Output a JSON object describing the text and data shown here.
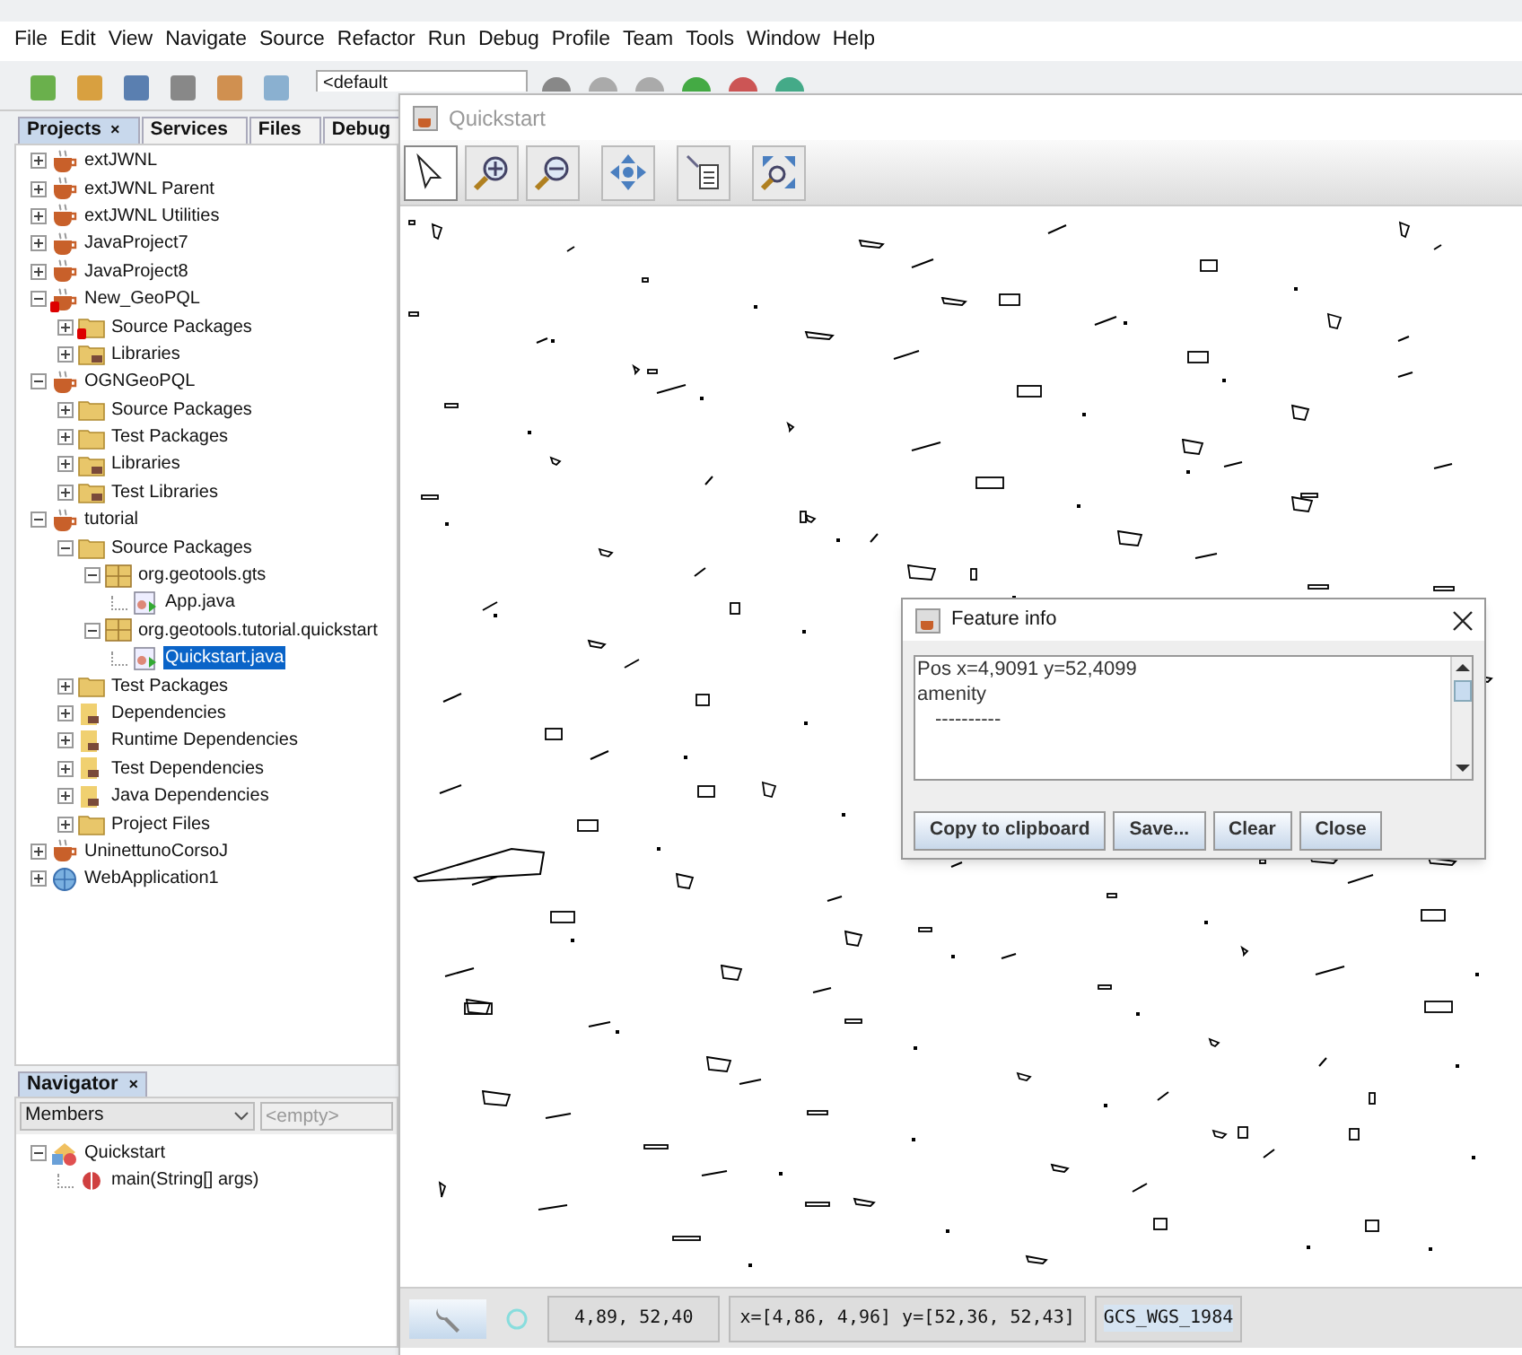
{
  "ide": {
    "menu": [
      "File",
      "Edit",
      "View",
      "Navigate",
      "Source",
      "Refactor",
      "Run",
      "Debug",
      "Profile",
      "Team",
      "Tools",
      "Window",
      "Help"
    ],
    "config_combo": {
      "value": "<default"
    }
  },
  "panel_tabs": [
    {
      "label": "Projects",
      "selected": true,
      "close": "×"
    },
    {
      "label": "Services",
      "selected": false
    },
    {
      "label": "Files",
      "selected": false
    },
    {
      "label": "Debug",
      "selected": false
    }
  ],
  "project_tree": [
    {
      "label": "extJWNL",
      "kind": "project",
      "expanded": false,
      "selected": false
    },
    {
      "label": "extJWNL Parent",
      "kind": "parent",
      "expanded": false,
      "selected": false
    },
    {
      "label": "extJWNL Utilities",
      "kind": "project",
      "expanded": false,
      "selected": false
    },
    {
      "label": "JavaProject7",
      "kind": "project",
      "expanded": false,
      "selected": false
    },
    {
      "label": "JavaProject8",
      "kind": "project",
      "expanded": false,
      "selected": false
    },
    {
      "label": "New_GeoPQL",
      "kind": "project-error",
      "expanded": true,
      "selected": false,
      "children": [
        {
          "label": "Source Packages",
          "kind": "folder-error",
          "expanded": false,
          "selected": false
        },
        {
          "label": "Libraries",
          "kind": "library",
          "expanded": false,
          "selected": false
        }
      ]
    },
    {
      "label": "OGNGeoPQL",
      "kind": "project",
      "expanded": true,
      "selected": false,
      "children": [
        {
          "label": "Source Packages",
          "kind": "folder",
          "expanded": false,
          "selected": false
        },
        {
          "label": "Test Packages",
          "kind": "folder",
          "expanded": false,
          "selected": false
        },
        {
          "label": "Libraries",
          "kind": "library",
          "expanded": false,
          "selected": false
        },
        {
          "label": "Test Libraries",
          "kind": "library",
          "expanded": false,
          "selected": false
        }
      ]
    },
    {
      "label": "tutorial",
      "kind": "project",
      "expanded": true,
      "selected": false,
      "children": [
        {
          "label": "Source Packages",
          "kind": "folder",
          "expanded": true,
          "selected": false,
          "children": [
            {
              "label": "org.geotools.gts",
              "kind": "package",
              "expanded": true,
              "selected": false,
              "children": [
                {
                  "label": "App.java",
                  "kind": "java",
                  "selected": false
                }
              ]
            },
            {
              "label": "org.geotools.tutorial.quickstart",
              "kind": "package",
              "expanded": true,
              "selected": false,
              "children": [
                {
                  "label": "Quickstart.java",
                  "kind": "java",
                  "selected": true
                }
              ]
            }
          ]
        },
        {
          "label": "Test Packages",
          "kind": "folder",
          "expanded": false,
          "selected": false
        },
        {
          "label": "Dependencies",
          "kind": "deps",
          "expanded": false,
          "selected": false
        },
        {
          "label": "Runtime Dependencies",
          "kind": "deps",
          "expanded": false,
          "selected": false
        },
        {
          "label": "Test Dependencies",
          "kind": "deps",
          "expanded": false,
          "selected": false
        },
        {
          "label": "Java Dependencies",
          "kind": "deps",
          "expanded": false,
          "selected": false
        },
        {
          "label": "Project Files",
          "kind": "folder",
          "expanded": false,
          "selected": false
        }
      ]
    },
    {
      "label": "UninettunoCorsoJ",
      "kind": "project",
      "expanded": false,
      "selected": false
    },
    {
      "label": "WebApplication1",
      "kind": "web",
      "expanded": false,
      "selected": false
    }
  ],
  "navigator": {
    "title": "Navigator",
    "close": "×",
    "filter": "Members",
    "search_placeholder": "<empty>",
    "tree": [
      {
        "label": "Quickstart",
        "kind": "class",
        "expanded": true,
        "children": [
          {
            "label": "main(String[] args)",
            "kind": "method"
          }
        ]
      }
    ]
  },
  "quickstart": {
    "title": "Quickstart",
    "tools": [
      {
        "kind": "pointer",
        "selected": true
      },
      {
        "kind": "zoom-in",
        "selected": false
      },
      {
        "kind": "zoom-out",
        "selected": false
      },
      {
        "kind": "pan",
        "selected": false
      },
      {
        "kind": "info",
        "selected": false
      },
      {
        "kind": "reset",
        "selected": false
      }
    ],
    "status": {
      "position": "4,89, 52,40",
      "extent": "x=[4,86, 4,96] y=[52,36, 52,43]",
      "crs": "GCS_WGS_1984"
    }
  },
  "feature_info": {
    "title": "Feature info",
    "lines": [
      "Pos x=4,9091 y=52,4099",
      "amenity",
      "----------"
    ],
    "buttons": [
      "Copy to clipboard",
      "Save...",
      "Clear",
      "Close"
    ]
  }
}
